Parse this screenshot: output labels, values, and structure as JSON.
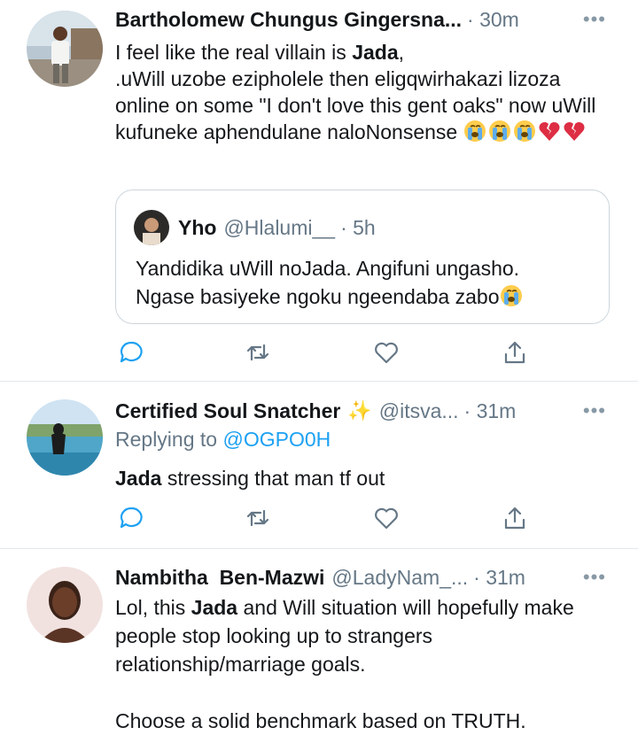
{
  "tweets": [
    {
      "name": "Bartholomew Chungus Gingersna...",
      "handle": "",
      "time": "· 30m",
      "more": "•••",
      "text_parts": [
        "I feel like the real villain is ",
        "Jada",
        ",",
        ".uWill uzobe ezipholele then eligqwirhakazi lizoza online on some \"I don't love this gent oaks\" now uWill kufuneke aphendulane naloNonsense"
      ],
      "emojis": [
        "loudly-crying-face",
        "loudly-crying-face",
        "loudly-crying-face",
        "broken-heart",
        "broken-heart"
      ],
      "quote": {
        "name": "Yho",
        "handle": "@Hlalumi__",
        "time": "· 5h",
        "text_line1": "Yandidika uWill noJada. Angifuni ungasho.",
        "text_line2": "Ngase basiyeke ngoku ngeendaba zabo",
        "emoji": "loudly-crying-face"
      }
    },
    {
      "name": "Certified Soul Snatcher",
      "badge": "✨",
      "handle": "@itsva...",
      "time": "· 31m",
      "more": "•••",
      "replying_prefix": "Replying to ",
      "replying_to": "@OGPO0H",
      "text_bold": "Jada",
      "text_rest": " stressing that man tf out"
    },
    {
      "name": "Nambitha  Ben-Mazwi",
      "handle": "@LadyNam_...",
      "time": "· 31m",
      "more": "•••",
      "text_pre": "Lol, this ",
      "text_bold": "Jada",
      "text_post": " and Will situation will hopefully make people stop looking up to strangers relationship/marriage goals.",
      "text_para2": "Choose a solid benchmark based on TRUTH."
    }
  ],
  "icons": {
    "reply": "reply-icon",
    "retweet": "retweet-icon",
    "like": "heart-icon",
    "share": "share-icon"
  },
  "colors": {
    "accent": "#1da1f2",
    "secondary_text": "#657786",
    "divider": "#e1e8ed"
  }
}
